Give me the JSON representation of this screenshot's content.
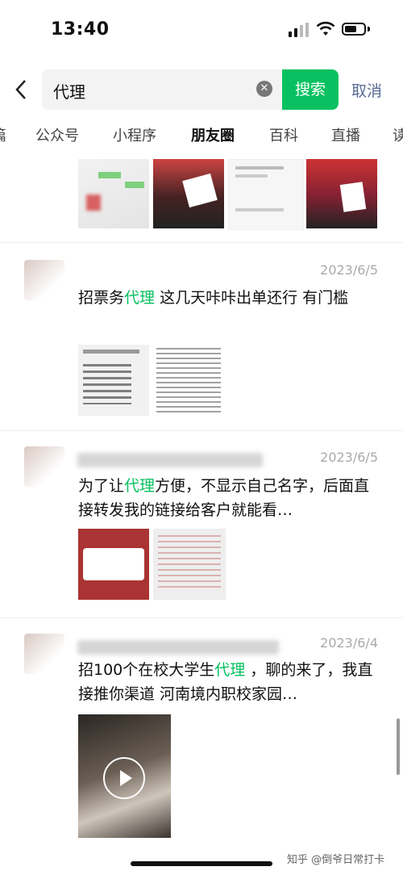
{
  "status": {
    "time": "13:40"
  },
  "search": {
    "query": "代理",
    "button": "搜索",
    "cancel": "取消"
  },
  "tabs": [
    "篇",
    "公众号",
    "小程序",
    "朋友圈",
    "百科",
    "直播",
    "读"
  ],
  "active_tab": "朋友圈",
  "posts": [
    {
      "date": "2023/6/5",
      "text_before": "招票务",
      "keyword": "代理",
      "text_after": " 这几天咔咔出单还行 有门槛"
    },
    {
      "date": "2023/6/5",
      "text_before": "为了让",
      "keyword": "代理",
      "text_after": "方便，不显示自己名字，后面直接转发我的链接给客户就能看…"
    },
    {
      "date": "2023/6/4",
      "text_before": "招100个在校大学生",
      "keyword": "代理",
      "text_after": " ，聊的来了，我直接推你渠道 河南境内职校家园…"
    }
  ],
  "watermark": "知乎 @倒爷日常打卡",
  "colors": {
    "accent": "#07c160",
    "link": "#576b95"
  }
}
